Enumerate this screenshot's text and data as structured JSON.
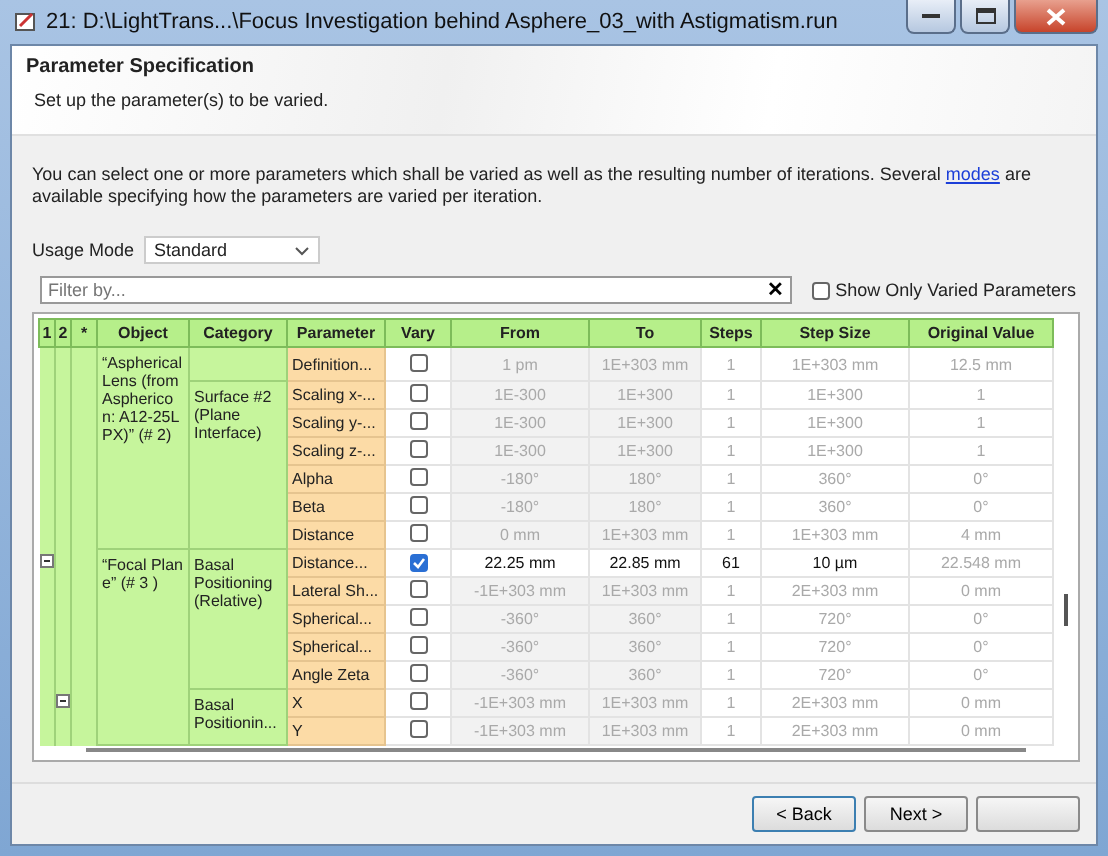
{
  "window": {
    "title": "21: D:\\LightTrans...\\Focus Investigation behind Asphere_03_with Astigmatism.run"
  },
  "header": {
    "title": "Parameter Specification",
    "subtitle": "Set up the parameter(s) to be varied."
  },
  "description": {
    "text": "You can select one or more parameters which shall be varied as well as the resulting number of iterations. Several",
    "link": "modes",
    "text_after": "are available specifying how the parameters are varied per iteration."
  },
  "usage_mode": {
    "label": "Usage Mode",
    "value": "Standard"
  },
  "filter": {
    "placeholder": "Filter by...",
    "clear": "✕"
  },
  "show_only_varied": {
    "label": "Show Only Varied Parameters",
    "checked": false
  },
  "table": {
    "columns": [
      "1",
      "2",
      "*",
      "Object",
      "Category",
      "Parameter",
      "Vary",
      "From",
      "To",
      "Steps",
      "Step Size",
      "Original Value"
    ],
    "objects": [
      {
        "name": "“Aspherical Lens (from Asphericon: A12-25LPX)” (# 2)",
        "categories": [
          {
            "rows": [
              {
                "parameter": "Definition...",
                "vary": false,
                "from": "1 pm",
                "to": "1E+303 mm",
                "steps": "1",
                "step_size": "1E+303 mm",
                "original_value": "12.5 mm"
              }
            ]
          },
          {
            "name": "Surface #2 (Plane Interface)",
            "rows": [
              {
                "parameter": "Scaling x-...",
                "vary": false,
                "from": "1E-300",
                "to": "1E+300",
                "steps": "1",
                "step_size": "1E+300",
                "original_value": "1"
              },
              {
                "parameter": "Scaling y-...",
                "vary": false,
                "from": "1E-300",
                "to": "1E+300",
                "steps": "1",
                "step_size": "1E+300",
                "original_value": "1"
              },
              {
                "parameter": "Scaling z-...",
                "vary": false,
                "from": "1E-300",
                "to": "1E+300",
                "steps": "1",
                "step_size": "1E+300",
                "original_value": "1"
              },
              {
                "parameter": "Alpha",
                "vary": false,
                "from": "-180°",
                "to": "180°",
                "steps": "1",
                "step_size": "360°",
                "original_value": "0°"
              },
              {
                "parameter": "Beta",
                "vary": false,
                "from": "-180°",
                "to": "180°",
                "steps": "1",
                "step_size": "360°",
                "original_value": "0°"
              },
              {
                "parameter": "Distance",
                "vary": false,
                "from": "0 mm",
                "to": "1E+303 mm",
                "steps": "1",
                "step_size": "1E+303 mm",
                "original_value": "4 mm"
              }
            ]
          }
        ]
      },
      {
        "name": "“Focal Plane” (# 3 )",
        "expanded": true,
        "categories": [
          {
            "name": "Basal Positioning (Relative)",
            "rows": [
              {
                "parameter": "Distance...",
                "vary": true,
                "from": "22.25 mm",
                "to": "22.85 mm",
                "steps": "61",
                "step_size": "10 µm",
                "original_value": "22.548 mm"
              },
              {
                "parameter": "Lateral Sh...",
                "vary": false,
                "from": "-1E+303 mm",
                "to": "1E+303 mm",
                "steps": "1",
                "step_size": "2E+303 mm",
                "original_value": "0 mm"
              },
              {
                "parameter": "Spherical...",
                "vary": false,
                "from": "-360°",
                "to": "360°",
                "steps": "1",
                "step_size": "720°",
                "original_value": "0°"
              },
              {
                "parameter": "Spherical...",
                "vary": false,
                "from": "-360°",
                "to": "360°",
                "steps": "1",
                "step_size": "720°",
                "original_value": "0°"
              },
              {
                "parameter": "Angle Zeta",
                "vary": false,
                "from": "-360°",
                "to": "360°",
                "steps": "1",
                "step_size": "720°",
                "original_value": "0°"
              }
            ]
          },
          {
            "name": "Basal Positionin...",
            "expanded": true,
            "rows": [
              {
                "parameter": "X",
                "vary": false,
                "from": "-1E+303 mm",
                "to": "1E+303 mm",
                "steps": "1",
                "step_size": "2E+303 mm",
                "original_value": "0 mm"
              },
              {
                "parameter": "Y",
                "vary": false,
                "from": "-1E+303 mm",
                "to": "1E+303 mm",
                "steps": "1",
                "step_size": "2E+303 mm",
                "original_value": "0 mm"
              }
            ]
          }
        ]
      }
    ]
  },
  "buttons": [
    "< Back",
    "Next >"
  ]
}
